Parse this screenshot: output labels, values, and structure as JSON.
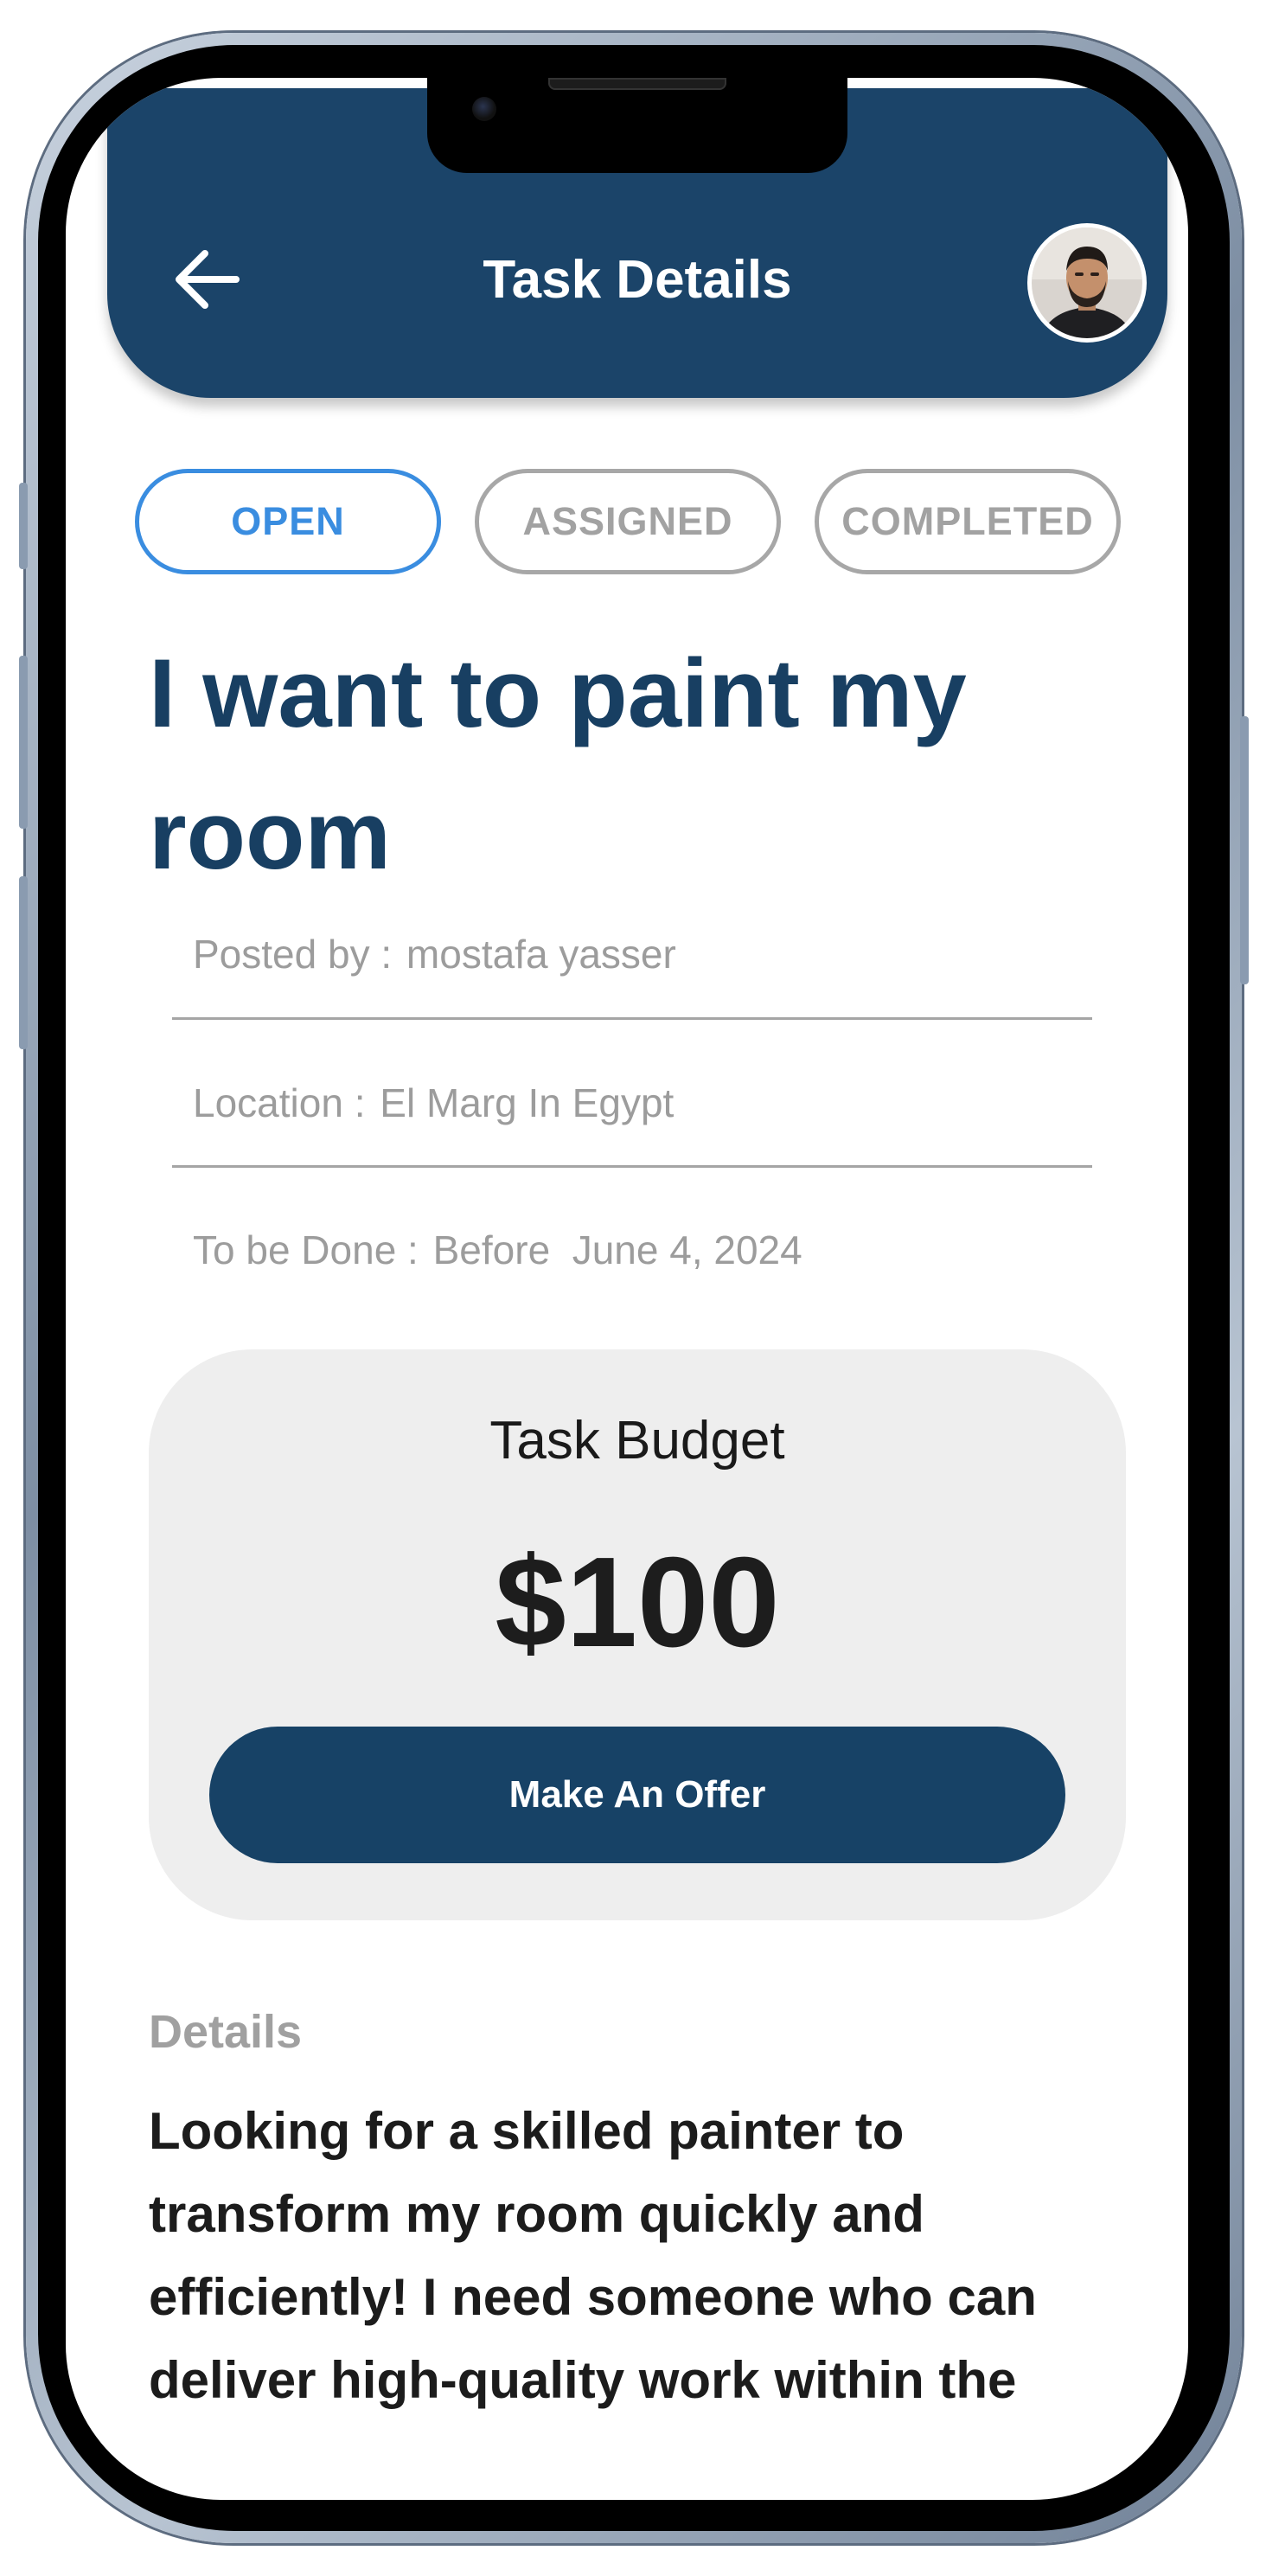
{
  "header": {
    "title": "Task Details",
    "back_icon": "arrow-left-icon",
    "avatar_icon": "user-avatar"
  },
  "tabs": [
    {
      "label": "OPEN",
      "active": true
    },
    {
      "label": "ASSIGNED",
      "active": false
    },
    {
      "label": "COMPLETED",
      "active": false
    }
  ],
  "task": {
    "title": "I want to paint my room",
    "posted_by_label": "Posted by :",
    "posted_by_value": "mostafa yasser",
    "location_label": "Location :",
    "location_value": "El Marg In Egypt",
    "due_label": "To be Done :",
    "due_value": "Before  June 4, 2024"
  },
  "budget": {
    "label": "Task Budget",
    "amount": "$100",
    "button_label": "Make An Offer"
  },
  "details": {
    "label": "Details",
    "text": "Looking for a skilled painter to transform my room quickly and efficiently! I need someone who can deliver high-quality work within the"
  },
  "colors": {
    "primary": "#1b4469",
    "accent": "#3a8de0",
    "muted": "#a2a2a2",
    "card": "#eeeeee"
  }
}
